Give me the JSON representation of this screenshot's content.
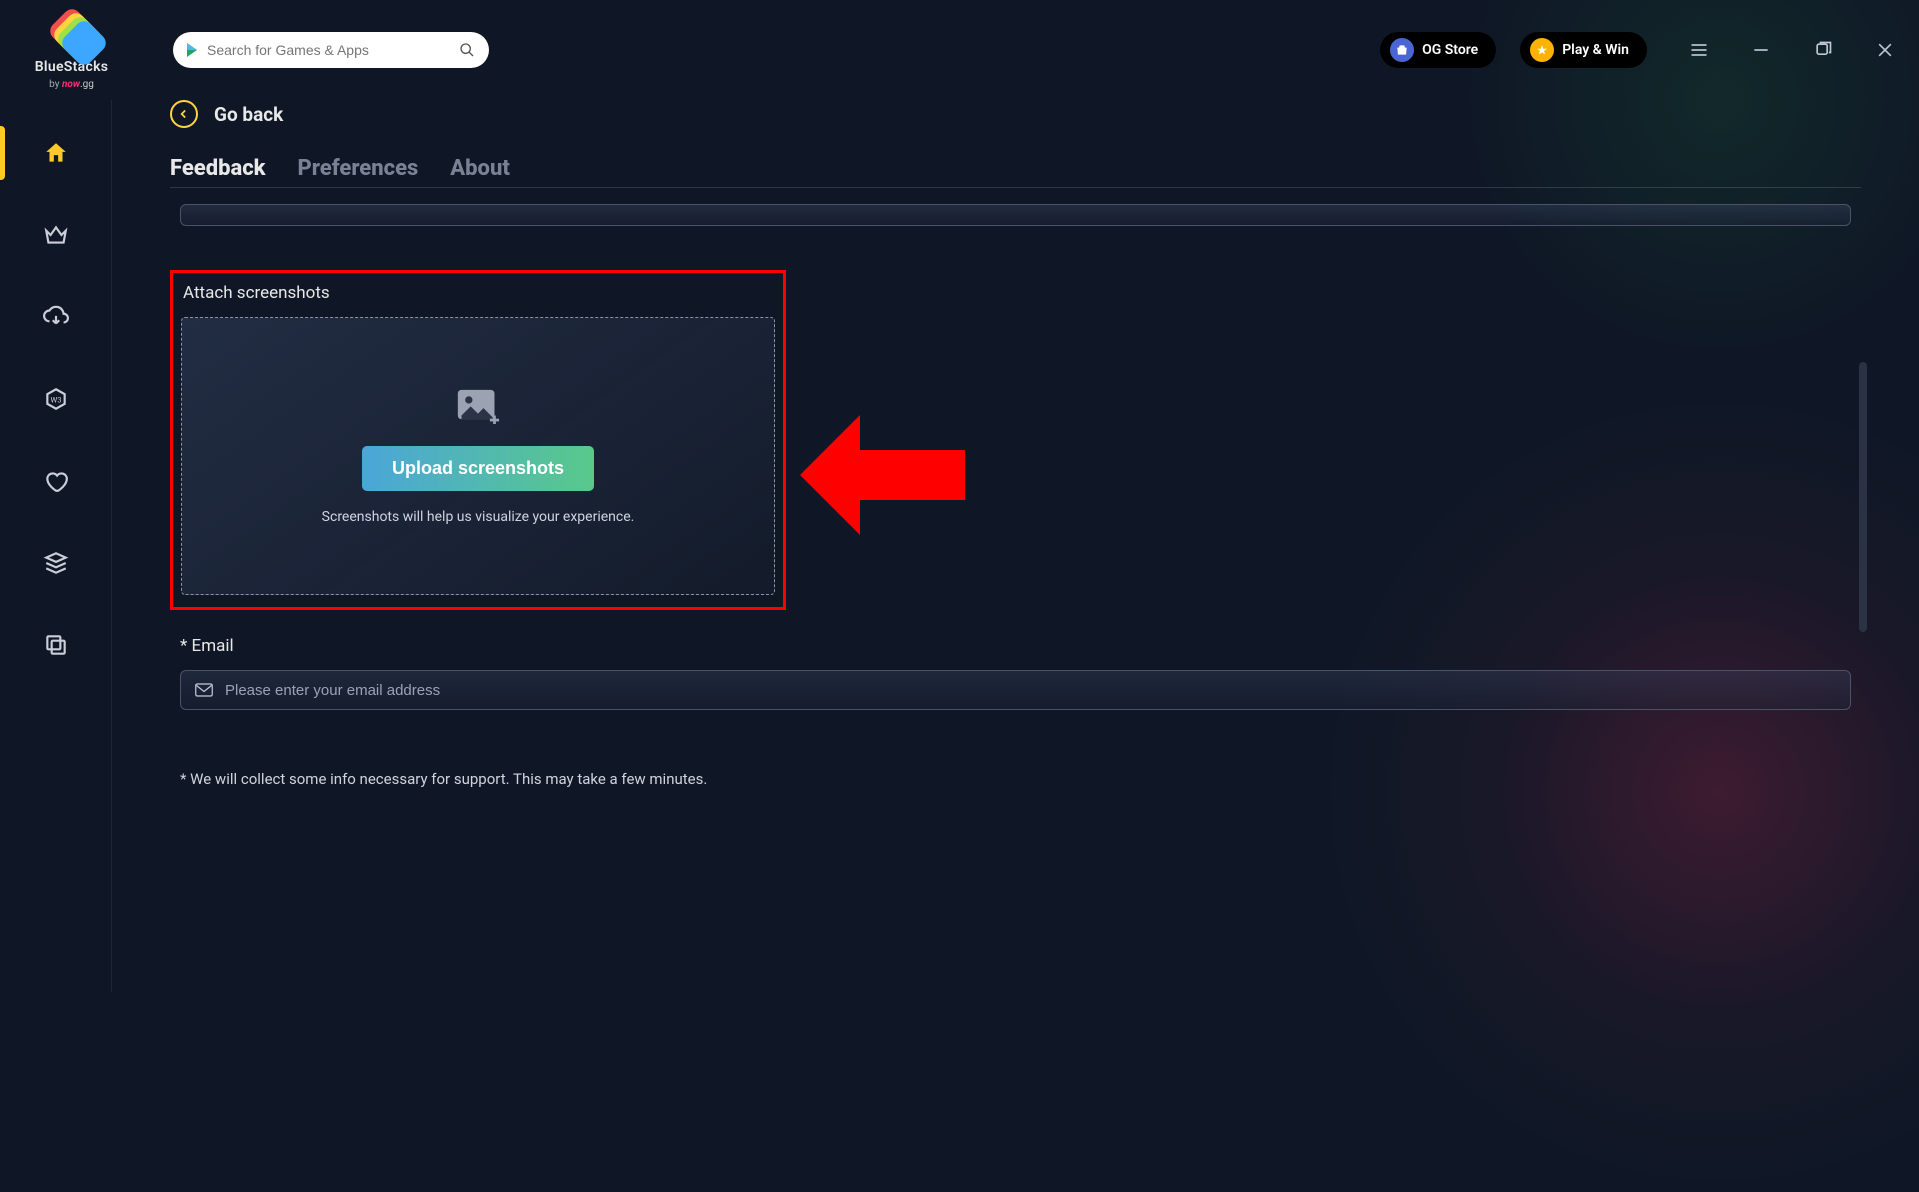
{
  "brand": {
    "name": "BlueStacks",
    "byline_prefix": "by ",
    "byline_brand": "now",
    "byline_suffix": ".gg"
  },
  "search": {
    "placeholder": "Search for Games & Apps"
  },
  "header_buttons": {
    "og_store": "OG Store",
    "play_win": "Play & Win"
  },
  "nav": {
    "back_label": "Go back",
    "tabs": {
      "feedback": "Feedback",
      "preferences": "Preferences",
      "about": "About"
    }
  },
  "feedback": {
    "attach_label": "Attach screenshots",
    "upload_button": "Upload screenshots",
    "upload_hint": "Screenshots will help us visualize your experience.",
    "email_label": "* Email",
    "email_placeholder": "Please enter your email address",
    "disclaimer": "* We will collect some info necessary for support. This may take a few minutes."
  }
}
